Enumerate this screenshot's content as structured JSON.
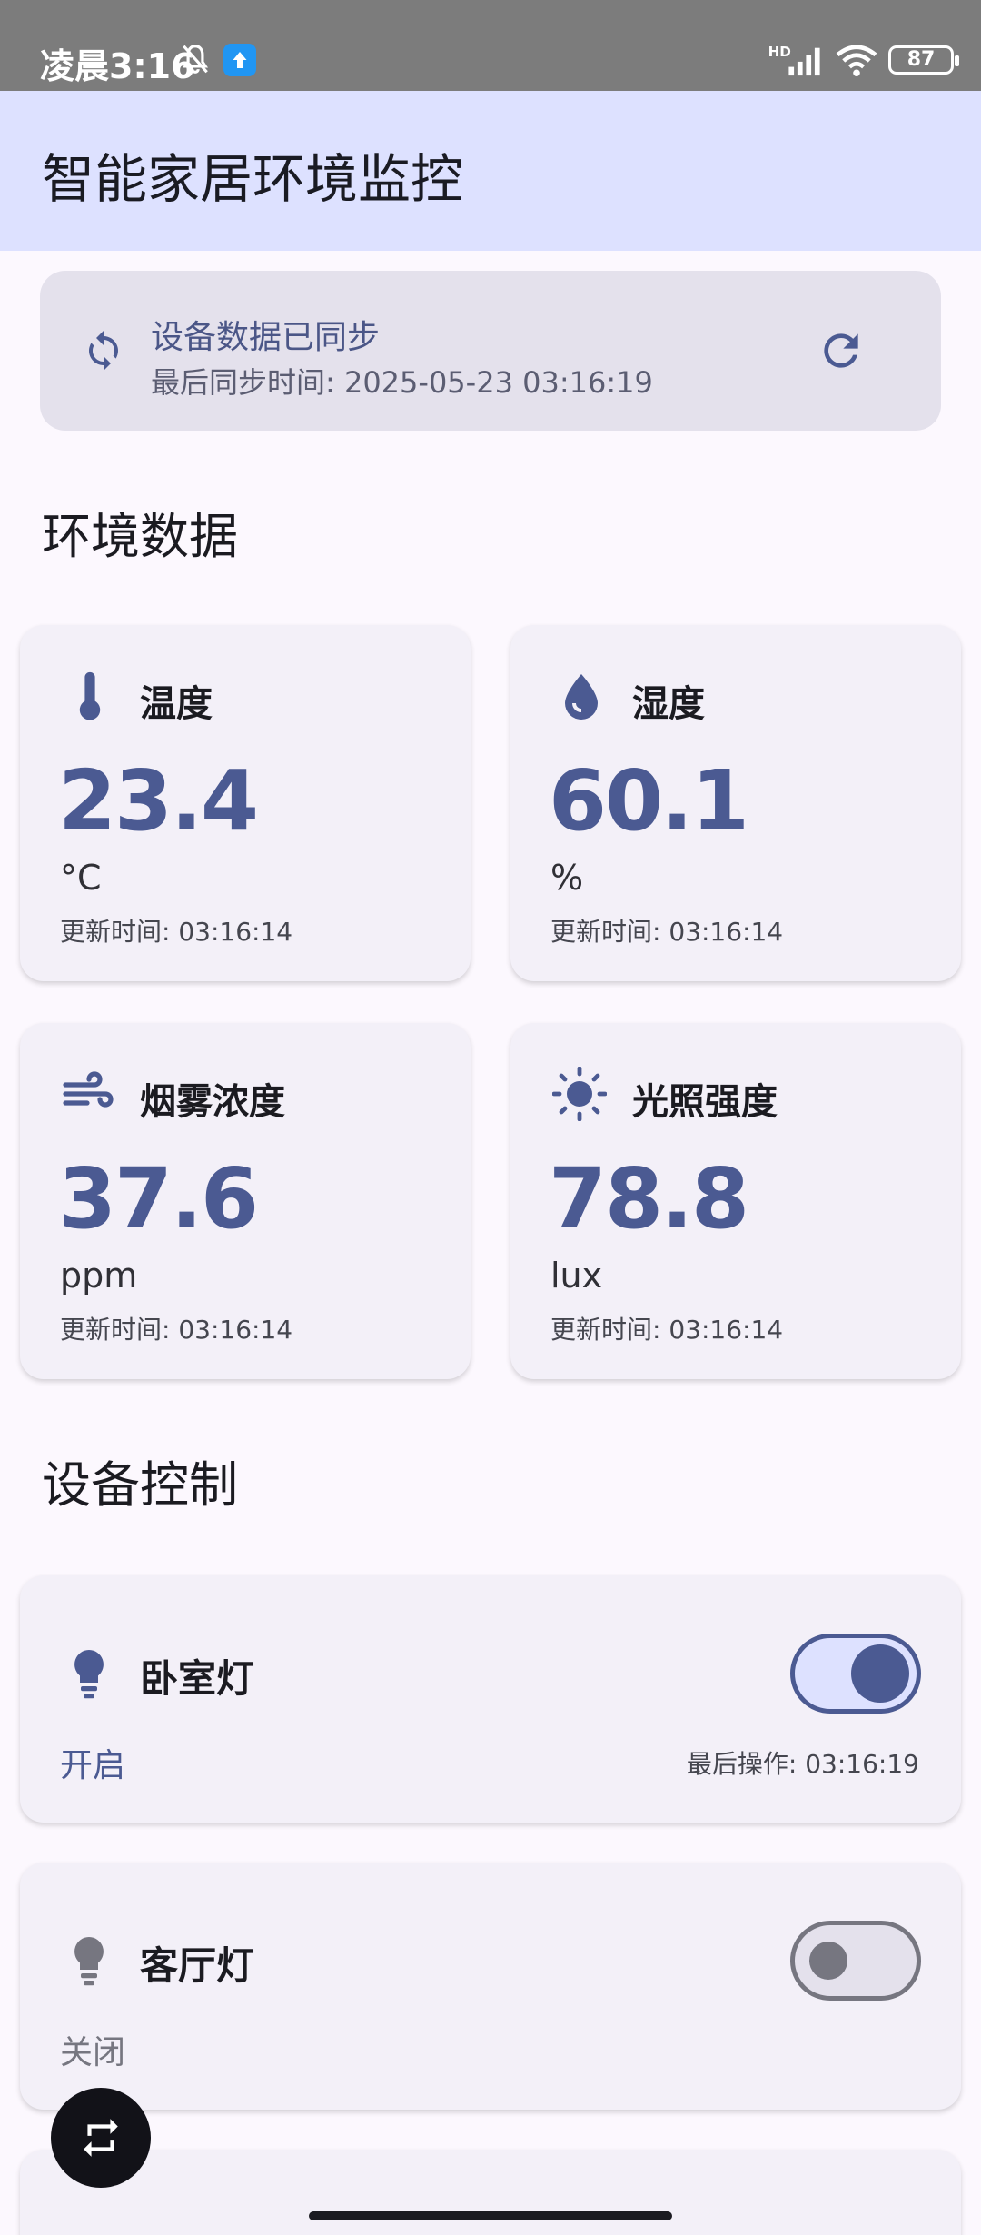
{
  "status_bar": {
    "time": "凌晨3:16",
    "battery": "87"
  },
  "app_bar": {
    "title": "智能家居环境监控"
  },
  "sync": {
    "title": "设备数据已同步",
    "time": "最后同步时间: 2025-05-23 03:16:19"
  },
  "sections": {
    "environment": "环境数据",
    "devices": "设备控制"
  },
  "sensors": [
    {
      "name": "温度",
      "value": "23.4",
      "unit": "°C",
      "updated": "更新时间: 03:16:14"
    },
    {
      "name": "湿度",
      "value": "60.1",
      "unit": "%",
      "updated": "更新时间: 03:16:14"
    },
    {
      "name": "烟雾浓度",
      "value": "37.6",
      "unit": "ppm",
      "updated": "更新时间: 03:16:14"
    },
    {
      "name": "光照强度",
      "value": "78.8",
      "unit": "lux",
      "updated": "更新时间: 03:16:14"
    }
  ],
  "devices": [
    {
      "name": "卧室灯",
      "state": "开启",
      "last": "最后操作: 03:16:19",
      "on": true
    },
    {
      "name": "客厅灯",
      "state": "关闭",
      "last": "",
      "on": false
    }
  ],
  "colors": {
    "primary": "#4b5a92",
    "app_bar": "#dde1ff",
    "card": "#f3f0f8",
    "sync_card": "#e4e1ec",
    "off": "#767680"
  }
}
